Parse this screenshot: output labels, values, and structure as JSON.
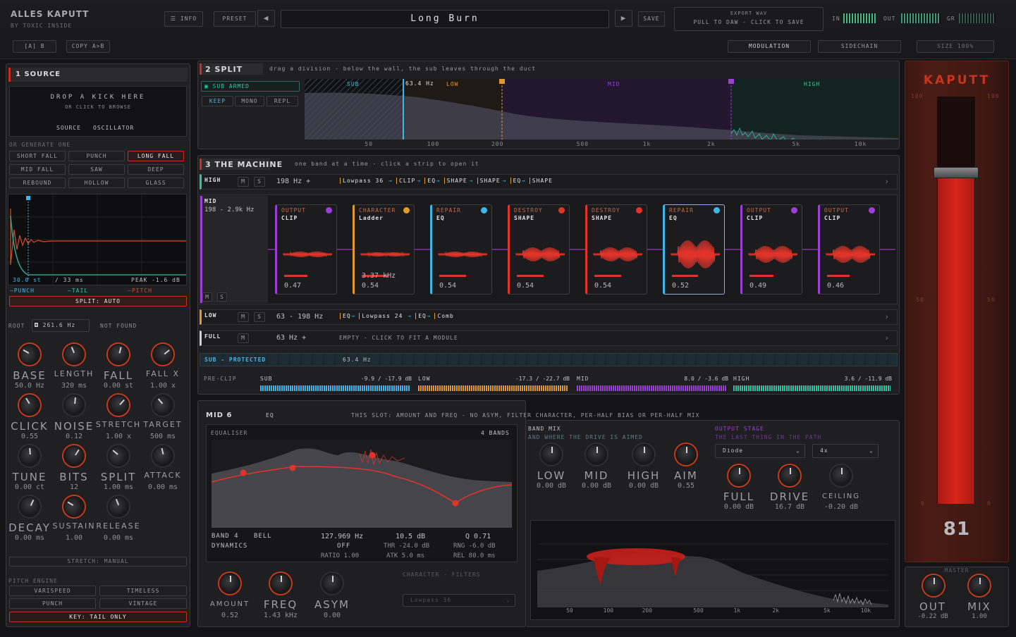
{
  "top": {
    "brand": "ALLES KAPUTT",
    "byline": "BY TOXIC INSIDE",
    "info": "INFO",
    "preset_label": "PRESET",
    "preset_name": "Long Burn",
    "save": "SAVE",
    "export_title": "EXPORT WAV",
    "export_sub": "PULL TO DAW  -  CLICK TO SAVE",
    "in_label": "IN",
    "out_label": "OUT",
    "gr_label": "GR",
    "ab": "[A]  B",
    "copy": "COPY A>B",
    "modulation": "MODULATION",
    "sidechain": "SIDECHAIN",
    "size": "SIZE  100%"
  },
  "source": {
    "title": "1  SOURCE",
    "drop1": "DROP A KICK HERE",
    "drop2": "OR CLICK TO BROWSE",
    "tab_source": "SOURCE",
    "tab_osc": "OSCILLATOR",
    "generate": "OR GENERATE ONE",
    "presets": [
      "SHORT FALL",
      "PUNCH",
      "LONG FALL",
      "MID FALL",
      "SAW",
      "DEEP",
      "REBOUND",
      "HOLLOW",
      "GLASS"
    ],
    "env_st": "30.0 st",
    "env_ms": "/ 33 ms",
    "env_peak": "PEAK -1.6 dB",
    "punch": "—PUNCH",
    "tail": "—TAIL",
    "pitch": "—PITCH",
    "split": "SPLIT: AUTO",
    "root_label": "ROOT",
    "root_val": "261.6 Hz",
    "not_found": "NOT FOUND",
    "knobs": [
      {
        "n": "BASE",
        "v": "50.0 Hz"
      },
      {
        "n": "LENGTH",
        "v": "320 ms"
      },
      {
        "n": "FALL",
        "v": "0.00 st"
      },
      {
        "n": "FALL X",
        "v": "1.00 x"
      },
      {
        "n": "CLICK",
        "v": "0.55"
      },
      {
        "n": "NOISE",
        "v": "0.12"
      },
      {
        "n": "STRETCH",
        "v": "1.00 x"
      },
      {
        "n": "TARGET",
        "v": "500 ms"
      },
      {
        "n": "TUNE",
        "v": "0.00 ct"
      },
      {
        "n": "BITS",
        "v": "12"
      },
      {
        "n": "SPLIT",
        "v": "1.00 ms"
      },
      {
        "n": "ATTACK",
        "v": "0.00 ms"
      },
      {
        "n": "DECAY",
        "v": "0.00 ms"
      },
      {
        "n": "SUSTAIN",
        "v": "1.00"
      },
      {
        "n": "RELEASE",
        "v": "0.00 ms"
      }
    ],
    "stretch": "STRETCH: MANUAL",
    "pitch_engine": "PITCH ENGINE",
    "varispeed": "VARISPEED",
    "timeless": "TIMELESS",
    "punch_b": "PUNCH",
    "vintage": "VINTAGE",
    "key": "KEY: TAIL ONLY"
  },
  "split": {
    "title": "2  SPLIT",
    "hint": "drag a division  -  below the wall, the sub leaves through the duct",
    "sub_armed": "SUB ARMED",
    "keep": "KEEP",
    "mono": "MONO",
    "repl": "REPL",
    "freq": "63.4 Hz",
    "zones": [
      "SUB",
      "LOW",
      "MID",
      "HIGH"
    ],
    "ticks": [
      "50",
      "100",
      "200",
      "500",
      "1k",
      "2k",
      "5k",
      "10k"
    ]
  },
  "machine": {
    "title": "3  THE MACHINE",
    "hint": "one band at a time  -  click a strip to open it",
    "high": {
      "name": "HIGH",
      "range": "198 Hz +",
      "chain": [
        "Lowpass 36",
        "CLIP",
        "EQ",
        "SHAPE",
        "SHAPE",
        "EQ",
        "SHAPE"
      ]
    },
    "mid": {
      "name": "MID",
      "range": "198 - 2.9k Hz"
    },
    "strips": [
      {
        "h": "OUTPUT",
        "t": "CLIP",
        "v": "0.47",
        "c": "#9b3fd6"
      },
      {
        "h": "CHARACTER",
        "t": "Ladder",
        "v": "0.54",
        "extra": "3.37 kHz",
        "c": "#e0992a"
      },
      {
        "h": "REPAIR",
        "t": "EQ",
        "v": "0.54",
        "c": "#3fb7e6"
      },
      {
        "h": "DESTROY",
        "t": "SHAPE",
        "v": "0.54",
        "c": "#e0342a"
      },
      {
        "h": "DESTROY",
        "t": "SHAPE",
        "v": "0.54",
        "c": "#e0342a"
      },
      {
        "h": "REPAIR",
        "t": "EQ",
        "v": "0.52",
        "c": "#3fb7e6"
      },
      {
        "h": "OUTPUT",
        "t": "CLIP",
        "v": "0.49",
        "c": "#9b3fd6"
      },
      {
        "h": "OUTPUT",
        "t": "CLIP",
        "v": "0.46",
        "c": "#9b3fd6"
      }
    ],
    "low": {
      "name": "LOW",
      "range": "63 - 198 Hz",
      "chain": [
        "EQ",
        "Lowpass 24",
        "EQ",
        "Comb"
      ]
    },
    "full": {
      "name": "FULL",
      "range": "63 Hz +",
      "empty": "EMPTY  -  CLICK TO FIT A MODULE"
    },
    "sub": {
      "name": "SUB  -  PROTECTED",
      "freq": "63.4 Hz"
    },
    "m": "M",
    "s": "S",
    "preclip": "PRE-CLIP",
    "meters": [
      {
        "n": "SUB",
        "v": "-9.9 / -17.9 dB",
        "c": "#3fb7e6"
      },
      {
        "n": "LOW",
        "v": "-17.3 / -22.7 dB",
        "c": "#e0992a"
      },
      {
        "n": "MID",
        "v": "8.0 / -3.6 dB",
        "c": "#9b3fd6"
      },
      {
        "n": "HIGH",
        "v": "3.6 / -11.9 dB",
        "c": "#2fc4a4"
      }
    ]
  },
  "eq": {
    "slot": "MID 6",
    "type": "EQ",
    "note": "THIS SLOT: AMOUNT AND FREQ  -  NO ASYM, FILTER CHARACTER, PER-HALF BIAS OR PER-HALF MIX",
    "title": "EQUALISER",
    "bands": "4 BANDS",
    "band": "BAND 4",
    "bell": "BELL",
    "freq": "127.969 Hz",
    "gain": "10.5 dB",
    "q": "Q 0.71",
    "dyn": "DYNAMICS",
    "off": "OFF",
    "thr": "THR -24.0 dB",
    "rng": "RNG -6.0 dB",
    "ratio": "RATIO 1.00",
    "atk": "ATK 5.0 ms",
    "rel": "REL 80.0 ms",
    "knobs": [
      {
        "n": "AMOUNT",
        "v": "0.52"
      },
      {
        "n": "FREQ",
        "v": "1.43 kHz"
      },
      {
        "n": "ASYM",
        "v": "0.00"
      }
    ],
    "char": "CHARACTER  -  FILTERS",
    "char_sel": "Lowpass 36"
  },
  "mix": {
    "title": "BAND MIX",
    "sub": "AND WHERE THE DRIVE IS AIMED",
    "knobs": [
      {
        "n": "LOW",
        "v": "0.00 dB"
      },
      {
        "n": "MID",
        "v": "0.00 dB"
      },
      {
        "n": "HIGH",
        "v": "0.00 dB"
      },
      {
        "n": "AIM",
        "v": "0.55"
      }
    ],
    "out_title": "OUTPUT STAGE",
    "out_sub": "THE LAST THING IN THE PATH",
    "mode": "Diode",
    "os": "4x",
    "out_knobs": [
      {
        "n": "FULL",
        "v": "0.00 dB"
      },
      {
        "n": "DRIVE",
        "v": "16.7 dB"
      },
      {
        "n": "CEILING",
        "v": "-0.20 dB"
      }
    ],
    "ticks": [
      "50",
      "100",
      "200",
      "500",
      "1k",
      "2k",
      "5k",
      "10k"
    ]
  },
  "kaputt": {
    "title": "KAPUTT",
    "scale": [
      "100",
      "50",
      "0"
    ],
    "value": "81",
    "level": 0.81,
    "master": "MASTER",
    "out": "OUT",
    "out_v": "-0.22 dB",
    "mix": "MIX",
    "mix_v": "1.00"
  }
}
